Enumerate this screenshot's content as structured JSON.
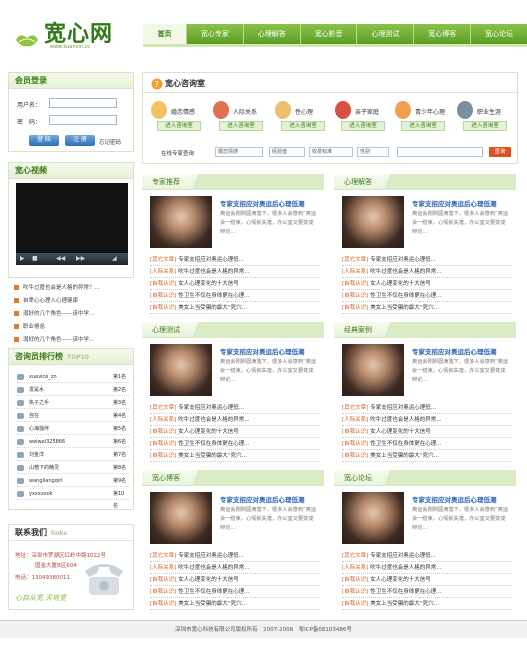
{
  "logo": {
    "title": "宽心网",
    "url": "www.kuanxin.cc"
  },
  "nav": {
    "items": [
      "首页",
      "宽心专家",
      "心理解答",
      "宽心影音",
      "心理测试",
      "宽心博客",
      "宽心论坛"
    ]
  },
  "login": {
    "title": "会员登录",
    "user_label": "用户名：",
    "pass_label": "密　码：",
    "login_btn": "登 陆",
    "register_btn": "注 册",
    "forgot": "忘记密码"
  },
  "video": {
    "title": "宽心视频",
    "videos": [
      "吹牛过度也会是人格的异常？...",
      "自卑心心理入心理健康",
      "溺好的几个角色——该中学...",
      "职业倦怠",
      "溺好的几个角色——该中学..."
    ]
  },
  "rank": {
    "title": "咨询员排行榜",
    "title_en": "TOP10",
    "rows": [
      {
        "name": "xuevice_zn",
        "pos": "第1名"
      },
      {
        "name": "发是水",
        "pos": "第2名"
      },
      {
        "name": "执子之手",
        "pos": "第3名"
      },
      {
        "name": "自在",
        "pos": "第4名"
      },
      {
        "name": "心海独伴",
        "pos": "第5名"
      },
      {
        "name": "weiwei325866",
        "pos": "第6名"
      },
      {
        "name": "刘金洋",
        "pos": "第7名"
      },
      {
        "name": "山楂下的精灵",
        "pos": "第8名"
      },
      {
        "name": "wangliangqirl",
        "pos": "第9名"
      },
      {
        "name": "yxxxxxok",
        "pos": "第10名"
      }
    ]
  },
  "contact": {
    "title": "联系我们",
    "title_en": "links",
    "address": "地址：深圳市罗湖区红岭中路1022号",
    "address2": "国金大厦B区604",
    "phone": "电话：13049380011",
    "slogan": "心自从宽 天地宽"
  },
  "consult": {
    "title": "宽心咨询室",
    "cats": [
      {
        "label": "婚恋情感",
        "go": "进入咨询室"
      },
      {
        "label": "人际关系",
        "go": "进入咨询室"
      },
      {
        "label": "性心理",
        "go": "进入咨询室"
      },
      {
        "label": "亲子家庭",
        "go": "进入咨询室"
      },
      {
        "label": "青少年心理",
        "go": "进入咨询室"
      },
      {
        "label": "职业生涯",
        "go": "进入咨询室"
      }
    ],
    "search_label": "在线专家查询",
    "selects": [
      "婚恋情感",
      "经验值",
      "收费标准",
      "性别"
    ],
    "search_btn": "查询"
  },
  "panels": [
    {
      "tab": "专家推荐",
      "title": "专家支招应对奥运后心理低潮",
      "desc": "奥运会刚刚圆满落下，很多人会感到“奥运会一结束，心情就失落，办公室又要变成辩论...",
      "items": [
        {
          "tag": "[其它文章]",
          "text": "专家支招应对奥运心理低..."
        },
        {
          "tag": "[人际关系]",
          "text": "吹牛过度也会是人格的异常..."
        },
        {
          "tag": "[自我认识]",
          "text": "女人心理变化的十大信号"
        },
        {
          "tag": "[自我认识]",
          "text": "性卫生不仅在身体更在心理..."
        },
        {
          "tag": "[自我认识]",
          "text": "美女上当受骗的最大“死穴..."
        }
      ]
    },
    {
      "tab": "心理解答",
      "title": "专家支招应对奥运后心理低潮",
      "desc": "奥运会刚刚圆满落下，很多人会感到“奥运会一结束，心情就失落，办公室又要变成辩论...",
      "items": [
        {
          "tag": "[其它文章]",
          "text": "专家支招应对奥运心理低..."
        },
        {
          "tag": "[人际关系]",
          "text": "吹牛过度也会是人格的异常..."
        },
        {
          "tag": "[自我认识]",
          "text": "女人心理变化的十大信号"
        },
        {
          "tag": "[自我认识]",
          "text": "性卫生不仅在身体更在心理..."
        },
        {
          "tag": "[自我认识]",
          "text": "美女上当受骗的最大“死穴..."
        }
      ]
    },
    {
      "tab": "心理测试",
      "title": "专家支招应对奥运后心理低潮",
      "desc": "奥运会刚刚圆满落下，很多人会感到“奥运会一结束，心情就失落，办公室又要变成辩论...",
      "items": [
        {
          "tag": "[其它文章]",
          "text": "专家支招应对奥运心理低..."
        },
        {
          "tag": "[人际关系]",
          "text": "吹牛过度也会是人格的异常..."
        },
        {
          "tag": "[自我认识]",
          "text": "女人心理变化的十大信号"
        },
        {
          "tag": "[自我认识]",
          "text": "性卫生不仅在身体更在心理..."
        },
        {
          "tag": "[自我认识]",
          "text": "美女上当受骗的最大“死穴..."
        }
      ]
    },
    {
      "tab": "经典案例",
      "title": "专家支招应对奥运后心理低潮",
      "desc": "奥运会刚刚圆满落下，很多人会感到“奥运会一结束，心情就失落，办公室又要变成辩论...",
      "items": [
        {
          "tag": "[其它文章]",
          "text": "专家支招应对奥运心理低..."
        },
        {
          "tag": "[人际关系]",
          "text": "吹牛过度也会是人格的异常..."
        },
        {
          "tag": "[自我认识]",
          "text": "女人心理变化的十大信号"
        },
        {
          "tag": "[自我认识]",
          "text": "性卫生不仅在身体更在心理..."
        },
        {
          "tag": "[自我认识]",
          "text": "美女上当受骗的最大“死穴..."
        }
      ]
    },
    {
      "tab": "宽心博客",
      "title": "专家支招应对奥运后心理低潮",
      "desc": "奥运会刚刚圆满落下，很多人会感到“奥运会一结束，心情就失落，办公室又要变成辩论...",
      "items": [
        {
          "tag": "[其它文章]",
          "text": "专家支招应对奥运心理低..."
        },
        {
          "tag": "[人际关系]",
          "text": "吹牛过度也会是人格的异常..."
        },
        {
          "tag": "[自我认识]",
          "text": "女人心理变化的十大信号"
        },
        {
          "tag": "[自我认识]",
          "text": "性卫生不仅在身体更在心理..."
        },
        {
          "tag": "[自我认识]",
          "text": "美女上当受骗的最大“死穴..."
        }
      ]
    },
    {
      "tab": "宽心论坛",
      "title": "专家支招应对奥运后心理低潮",
      "desc": "奥运会刚刚圆满落下，很多人会感到“奥运会一结束，心情就失落，办公室又要变成辩论...",
      "items": [
        {
          "tag": "[其它文章]",
          "text": "专家支招应对奥运心理低..."
        },
        {
          "tag": "[人际关系]",
          "text": "吹牛过度也会是人格的异常..."
        },
        {
          "tag": "[自我认识]",
          "text": "女人心理变化的十大信号"
        },
        {
          "tag": "[自我认识]",
          "text": "性卫生不仅在身体更在心理..."
        },
        {
          "tag": "[自我认识]",
          "text": "美女上当受骗的最大“死穴..."
        }
      ]
    }
  ],
  "footer": {
    "text": "深圳市宽心科技有限公司版权所有　2007-2008　粤ICP备08103486号"
  }
}
